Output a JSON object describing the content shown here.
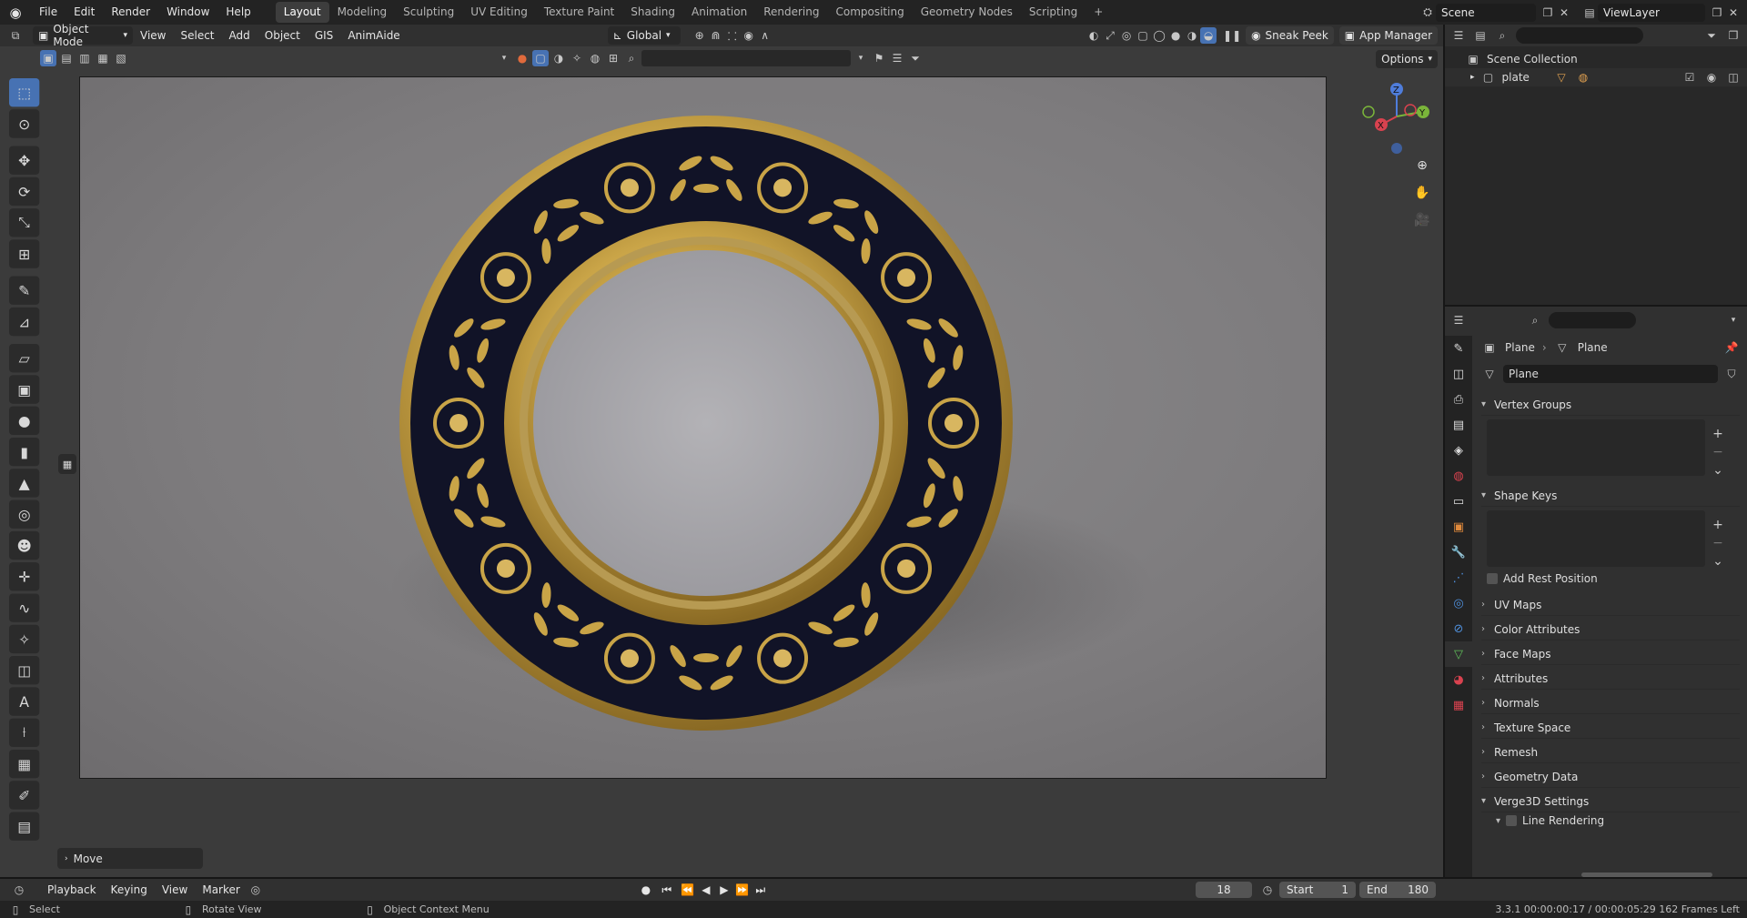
{
  "topbar": {
    "menus": [
      "File",
      "Edit",
      "Render",
      "Window",
      "Help"
    ],
    "workspaces": [
      "Layout",
      "Modeling",
      "Sculpting",
      "UV Editing",
      "Texture Paint",
      "Shading",
      "Animation",
      "Rendering",
      "Compositing",
      "Geometry Nodes",
      "Scripting"
    ],
    "active_workspace": "Layout",
    "add_tab": "+",
    "scene": "Scene",
    "view_layer": "ViewLayer"
  },
  "header": {
    "mode": "Object Mode",
    "menus": [
      "View",
      "Select",
      "Add",
      "Object",
      "GIS",
      "AnimAide"
    ],
    "transform_orientation": "Global",
    "sneak_peek": "Sneak Peek",
    "app_manager": "App Manager",
    "options": "Options"
  },
  "viewport": {
    "object_name": "plate",
    "gizmo_axes": [
      "X",
      "Y",
      "Z"
    ],
    "last_operator": "Move",
    "colors": {
      "plate_rim": "#111327",
      "gold": "#c9a447",
      "plate_center": "#a9a8ad"
    }
  },
  "toolbar": {
    "tools": [
      "select-box",
      "cursor",
      "move",
      "rotate",
      "scale",
      "transform",
      "annotate",
      "measure",
      "add-plane",
      "add-cube",
      "add-sphere",
      "add-cylinder",
      "add-cone",
      "add-torus",
      "add-monkey",
      "add-empty",
      "add-curve",
      "add-light",
      "add-camera",
      "add-text",
      "add-armature",
      "add-lattice",
      "add-grease",
      "add-image"
    ]
  },
  "outliner": {
    "root": "Scene Collection",
    "items": [
      {
        "name": "plate"
      }
    ]
  },
  "properties": {
    "breadcrumb": [
      "Plane",
      "Plane"
    ],
    "datablock": "Plane",
    "panels": {
      "vertex_groups": "Vertex Groups",
      "shape_keys": "Shape Keys",
      "add_rest_position": "Add Rest Position",
      "uv_maps": "UV Maps",
      "color_attributes": "Color Attributes",
      "face_maps": "Face Maps",
      "attributes": "Attributes",
      "normals": "Normals",
      "texture_space": "Texture Space",
      "remesh": "Remesh",
      "geometry_data": "Geometry Data",
      "verge3d": "Verge3D Settings",
      "line_rendering": "Line Rendering"
    }
  },
  "timeline": {
    "menus": [
      "Playback",
      "Keying",
      "View",
      "Marker"
    ],
    "current_frame": "18",
    "start_label": "Start",
    "start": "1",
    "end_label": "End",
    "end": "180"
  },
  "statusbar": {
    "select": "Select",
    "rotate_view": "Rotate View",
    "context_menu": "Object Context Menu",
    "info": "3.3.1  00:00:00:17 / 00:00:05:29  162 Frames Left"
  }
}
